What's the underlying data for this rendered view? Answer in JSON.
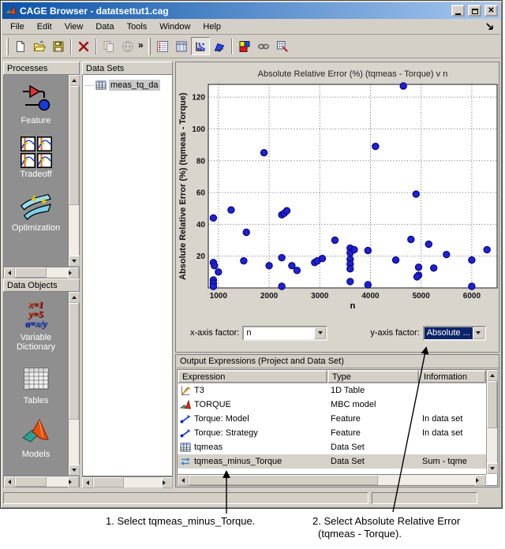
{
  "window": {
    "title": "CAGE Browser - datatsettut1.cag"
  },
  "menu": {
    "items": [
      "File",
      "Edit",
      "View",
      "Data",
      "Tools",
      "Window",
      "Help"
    ]
  },
  "toolbar": {
    "overflow": "»",
    "file_buttons": [
      {
        "name": "new-file-button",
        "icon": "new-file-icon",
        "enabled": true
      },
      {
        "name": "open-file-button",
        "icon": "open-file-icon",
        "enabled": true
      },
      {
        "name": "save-button",
        "icon": "save-icon",
        "enabled": true
      },
      {
        "sep": true
      },
      {
        "name": "delete-button",
        "icon": "delete-icon",
        "enabled": true
      },
      {
        "sep": true
      },
      {
        "name": "copy-button",
        "icon": "copy-grayed-icon",
        "enabled": false
      },
      {
        "name": "render-button",
        "icon": "render-grayed-icon",
        "enabled": false
      }
    ],
    "view_buttons": [
      {
        "name": "view-data-button",
        "icon": "view-data-icon",
        "active": false
      },
      {
        "name": "view-table-button",
        "icon": "view-table-icon",
        "active": false
      },
      {
        "name": "view-plot-button",
        "icon": "view-plot-icon",
        "active": true
      },
      {
        "name": "view-surface-button",
        "icon": "view-surface-icon",
        "active": false
      },
      {
        "sep": true
      },
      {
        "name": "color-button",
        "icon": "color-icon",
        "active": false
      },
      {
        "name": "link-button",
        "icon": "link-icon",
        "active": false
      },
      {
        "name": "export-button",
        "icon": "export-icon",
        "active": false
      }
    ]
  },
  "sidebar": {
    "processes": {
      "title": "Processes",
      "items": [
        {
          "label": "Feature",
          "icon": "feature-icon"
        },
        {
          "label": "Tradeoff",
          "icon": "tradeoff-icon"
        },
        {
          "label": "Optimization",
          "icon": "optimization-icon"
        }
      ]
    },
    "data_objects": {
      "title": "Data Objects",
      "items": [
        {
          "label": "Variable Dictionary",
          "icon": "variable-dictionary-icon"
        },
        {
          "label": "Tables",
          "icon": "tables-icon"
        },
        {
          "label": "Models",
          "icon": "models-icon"
        }
      ]
    },
    "variable_icon_lines": [
      "x=1",
      "y=5",
      "a=x/y"
    ]
  },
  "datasets": {
    "title": "Data Sets",
    "items": [
      {
        "label": "meas_tq_da",
        "icon": "dataset-table-icon",
        "selected": true
      }
    ]
  },
  "chart_data": {
    "type": "scatter",
    "title": "Absolute Relative Error (%) (tqmeas - Torque) v n",
    "xlabel": "n",
    "ylabel": "Absolute Relative Error (%) (tqmeas - Torque)",
    "xlim": [
      800,
      6500
    ],
    "ylim": [
      0,
      128
    ],
    "xticks": [
      1000,
      2000,
      3000,
      4000,
      5000,
      6000
    ],
    "yticks": [
      20,
      40,
      60,
      80,
      100,
      120
    ],
    "grid": "dotted",
    "legend": "none",
    "marker_color": "#2020cc",
    "points": [
      [
        900,
        44
      ],
      [
        900,
        16
      ],
      [
        920,
        14
      ],
      [
        1000,
        10
      ],
      [
        900,
        5
      ],
      [
        900,
        3
      ],
      [
        900,
        1
      ],
      [
        1250,
        49
      ],
      [
        1500,
        17
      ],
      [
        1550,
        35
      ],
      [
        1900,
        85
      ],
      [
        2000,
        14
      ],
      [
        2250,
        46
      ],
      [
        2300,
        47
      ],
      [
        2350,
        48.5
      ],
      [
        2250,
        19
      ],
      [
        2250,
        1
      ],
      [
        2450,
        14
      ],
      [
        2550,
        11
      ],
      [
        2900,
        16
      ],
      [
        2950,
        17
      ],
      [
        3050,
        18.5
      ],
      [
        3300,
        30
      ],
      [
        3600,
        25
      ],
      [
        3600,
        22
      ],
      [
        3600,
        18
      ],
      [
        3600,
        15
      ],
      [
        3600,
        12
      ],
      [
        3600,
        4
      ],
      [
        3680,
        24
      ],
      [
        3950,
        23.5
      ],
      [
        3950,
        2
      ],
      [
        4100,
        89
      ],
      [
        4500,
        17.5
      ],
      [
        4650,
        127
      ],
      [
        4800,
        30.5
      ],
      [
        4900,
        59
      ],
      [
        4950,
        13
      ],
      [
        4950,
        8
      ],
      [
        4920,
        7
      ],
      [
        5150,
        27.5
      ],
      [
        5250,
        12.5
      ],
      [
        5500,
        21
      ],
      [
        6000,
        17.5
      ],
      [
        6000,
        1
      ],
      [
        6300,
        24
      ]
    ]
  },
  "factors": {
    "x_label": "x-axis factor:",
    "x_value": "n",
    "y_label": "y-axis factor:",
    "y_value": "Absolute ..."
  },
  "output_expressions": {
    "header": "Output Expressions (Project and Data Set)",
    "columns": [
      "Expression",
      "Type",
      "Information"
    ],
    "rows": [
      {
        "expression": "T3",
        "type": "1D Table",
        "information": "",
        "icon": "table-1d-icon",
        "selected": false
      },
      {
        "expression": "TORQUE",
        "type": "MBC model",
        "information": "",
        "icon": "mbc-model-icon",
        "selected": false
      },
      {
        "expression": "Torque: Model",
        "type": "Feature",
        "information": "In data set",
        "icon": "feature-expression-icon",
        "selected": false
      },
      {
        "expression": "Torque: Strategy",
        "type": "Feature",
        "information": "In data set",
        "icon": "feature-expression-icon",
        "selected": false
      },
      {
        "expression": "tqmeas",
        "type": "Data Set",
        "information": "",
        "icon": "dataset-table-icon",
        "selected": false
      },
      {
        "expression": "tqmeas_minus_Torque",
        "type": "Data Set",
        "information": "Sum - tqme",
        "icon": "sum-expression-icon",
        "selected": true
      }
    ]
  },
  "annotations": {
    "step1": "1. Select tqmeas_minus_Torque.",
    "step2": [
      "2. Select Absolute Relative Error",
      "(tqmeas - Torque)."
    ]
  },
  "colors": {
    "chrome": "#d4d0c8",
    "titlebar_start": "#0b53a8",
    "titlebar_end": "#a6c8f0",
    "selection_blue": "#0a246a",
    "marker": "#2020cc"
  }
}
